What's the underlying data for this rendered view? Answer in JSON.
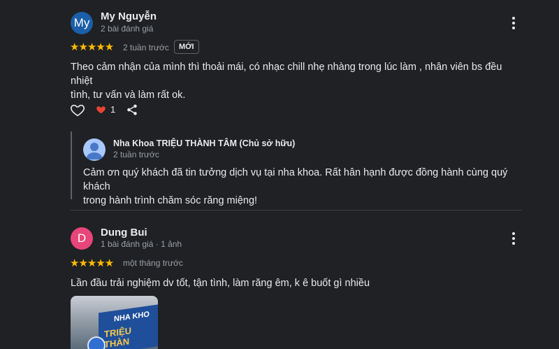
{
  "review1": {
    "avatar_text": "My",
    "avatar_color": "#1a5fa8",
    "name": "My Nguyễn",
    "meta": "2 bài đánh giá",
    "stars": "★★★★★",
    "time": "2 tuần trước",
    "badge": "MỚI",
    "text_line1": "Theo cảm nhận của mình thì thoải mái, có nhạc chill nhẹ nhàng trong lúc làm , nhân viên bs đều nhiệt",
    "text_line2": "tình, tư vấn và làm rất ok.",
    "likes": "1"
  },
  "reply": {
    "name": "Nha Khoa TRIỆU THÀNH TÂM (Chủ sở hữu)",
    "time": "2 tuần trước",
    "text_line1": "Cảm ơn quý khách đã tin tưởng dịch vụ tại nha khoa. Rất hân hạnh được đồng hành cùng quý khách",
    "text_line2": "trong hành trình chăm sóc răng miệng!"
  },
  "review2": {
    "avatar_text": "D",
    "avatar_color": "#e8457a",
    "name": "Dung Bui",
    "meta": "1 bài đánh giá · 1 ảnh",
    "stars": "★★★★★",
    "time": "một tháng trước",
    "text": "Lần đầu trải nghiệm dv tốt, tận tình, làm răng êm, k ê buốt gì nhiều",
    "photo_text_line1": "NHA KHO",
    "photo_text_line2": "TRIỆU THÀN"
  },
  "icons": {
    "heart": "heart-outline-icon",
    "heart_filled": "heart-filled-icon",
    "share": "share-icon",
    "more": "more-vert-icon",
    "person": "person-icon"
  }
}
